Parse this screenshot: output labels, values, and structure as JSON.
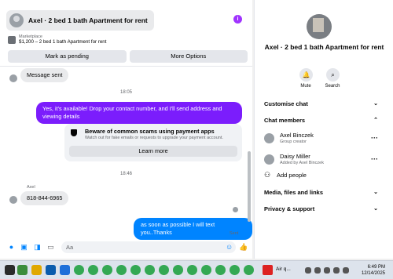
{
  "header": {
    "title": "Axel · 2 bed 1 bath Apartment for rent",
    "info_icon": "info-icon"
  },
  "listing": {
    "source": "Marketplace",
    "summary": "$1,200 – 2 bed 1 bath Apartment for rent"
  },
  "actions": {
    "mark_pending": "Mark as pending",
    "more_options": "More Options"
  },
  "messages": {
    "msg1": "Message sent",
    "ts1": "18:05",
    "msg2": "Yes, it's available! Drop your contact number, and I'll send address and viewing details",
    "scam_title": "Beware of common scams using payment apps",
    "scam_desc": "Watch out for fake emails or requests to upgrade your payment account.",
    "learn_more": "Learn more",
    "ts2": "18:46",
    "sender": "Axel",
    "msg3": "818-844-6965",
    "msg4": "as soon as possible I will text you..Thanks",
    "sent": "Sent"
  },
  "composer": {
    "placeholder": "Aa"
  },
  "side": {
    "title": "Axel · 2 bed 1 bath Apartment for rent",
    "mute": "Mute",
    "search": "Search",
    "customise": "Customise chat",
    "members": "Chat members",
    "member1_name": "Axel Binczek",
    "member1_role": "Group creator",
    "member2_name": "Daisy Miller",
    "member2_role": "Added by Axel Binczek",
    "add_people": "Add people",
    "media": "Media, files and links",
    "privacy": "Privacy & support"
  },
  "taskbar": {
    "app_label": "Air q...",
    "time": "6:49 PM",
    "date": "12/14/2025"
  },
  "colors": {
    "accent": "#0084ff",
    "purple": "#7b1dfc",
    "info": "#a033ff"
  }
}
